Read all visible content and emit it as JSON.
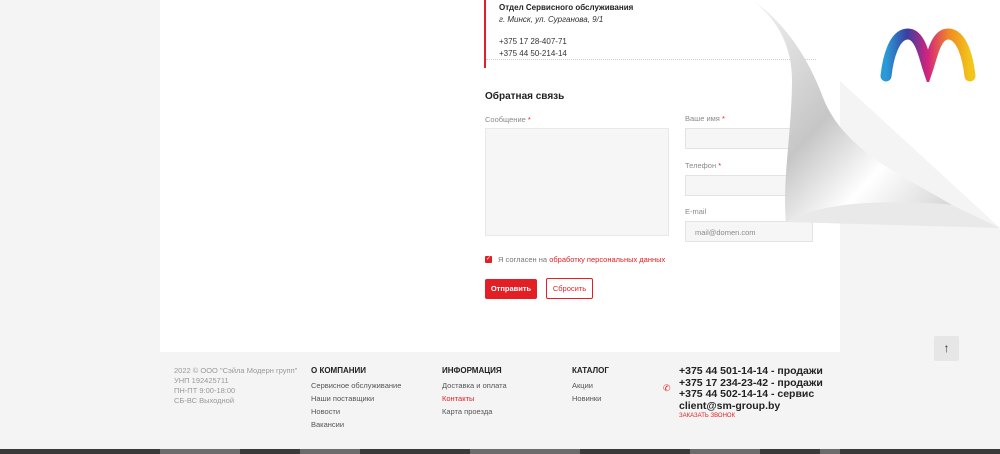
{
  "service": {
    "title": "Отдел Сервисного обслуживания",
    "address": "г. Минск, ул. Сурганова, 9/1",
    "phones": [
      "+375 17 28-407-71",
      "+375 44 50-214-14"
    ]
  },
  "form": {
    "title": "Обратная связь",
    "message_label": "Сообщение",
    "name_label": "Ваше имя",
    "phone_label": "Телефон",
    "email_label": "E-mail",
    "email_placeholder": "mail@domen.com",
    "required_mark": "*",
    "consent_text": "Я согласен на",
    "consent_link": "обработку персональных данных",
    "submit_label": "Отправить",
    "reset_label": "Сбросить"
  },
  "footer": {
    "copyright": [
      "2022 © ООО \"Сэйла Модерн групп\"",
      "УНП 192425711",
      "ПН-ПТ 9:00-18:00",
      "СБ-ВС Выходной"
    ],
    "columns": [
      {
        "title": "О КОМПАНИИ",
        "links": [
          "Сервисное обслуживание",
          "Наши поставщики",
          "Новости",
          "Вакансии"
        ]
      },
      {
        "title": "ИНФОРМАЦИЯ",
        "links": [
          "Доставка и оплата",
          "Контакты",
          "Карта проезда"
        ],
        "active_index": 1
      },
      {
        "title": "КАТАЛОГ",
        "links": [
          "Акции",
          "Новинки"
        ]
      }
    ],
    "phones": [
      "+375 44 501-14-14 - продажи",
      "+375 17 234-23-42 - продажи",
      "+375 44 502-14-14 - сервис",
      "client@sm-group.by"
    ],
    "callback_label": "заказать звонок"
  },
  "icons": {
    "scroll_top": "arrow-up-icon",
    "phone": "phone-icon",
    "check": "check-icon"
  },
  "colors": {
    "accent": "#e31e24",
    "background": "#f4f4f4",
    "panel": "#ffffff"
  }
}
